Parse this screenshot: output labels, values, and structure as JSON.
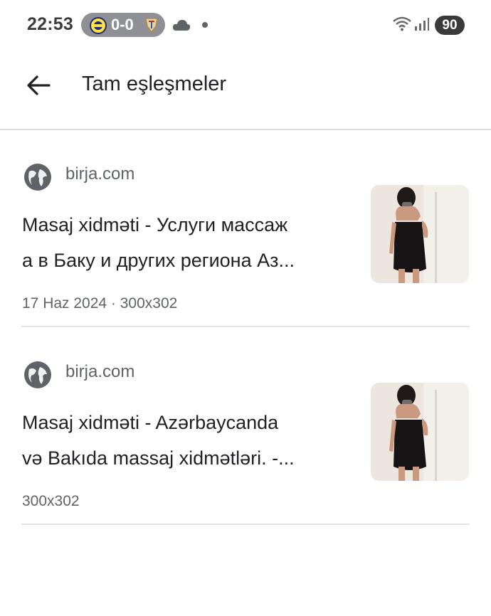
{
  "status_bar": {
    "time": "22:53",
    "score": "0-0",
    "battery": "90"
  },
  "app_bar": {
    "title": "Tam eşleşmeler",
    "back_icon": "arrow-left-icon"
  },
  "results": [
    {
      "site": "birja.com",
      "title_line1": "Masaj xidməti - Услуги массаж",
      "title_line2": "а в Баку и других региона Аз...",
      "meta": "17 Haz 2024 · 300x302",
      "icon": "globe-icon"
    },
    {
      "site": "birja.com",
      "title_line1": "Masaj xidməti - Azərbaycanda",
      "title_line2": "və Bakıda massaj xidmətləri. -...",
      "meta": "300x302",
      "icon": "globe-icon"
    }
  ],
  "colors": {
    "text_primary": "#202124",
    "text_secondary": "#5f6368",
    "divider": "#e3e3e3",
    "pill": "#8f9095"
  }
}
